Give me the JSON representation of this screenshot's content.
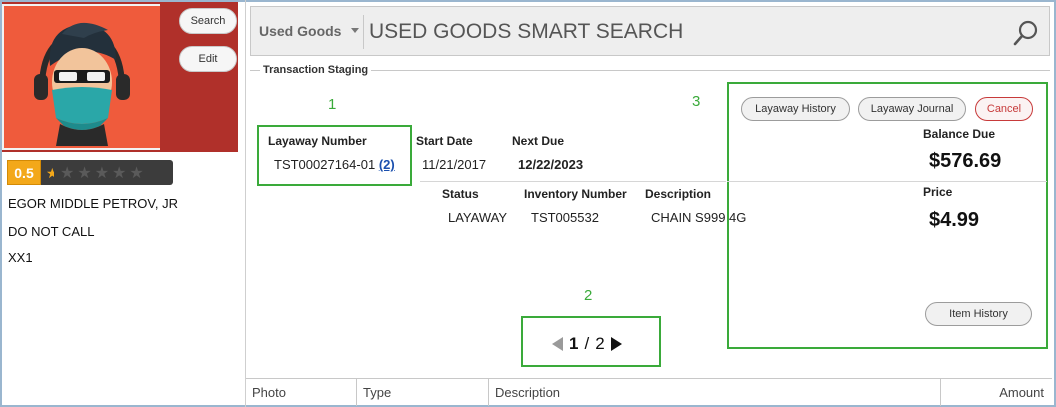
{
  "customer": {
    "search_label": "Search",
    "edit_label": "Edit",
    "rating": "0.5",
    "name": "EGOR MIDDLE PETROV, JR",
    "note": "DO NOT CALL",
    "code": "XX1"
  },
  "search": {
    "category": "Used Goods",
    "placeholder": "USED GOODS SMART SEARCH"
  },
  "staging": {
    "title": "Transaction Staging",
    "layaway_number_label": "Layaway Number",
    "layaway_number": "TST00027164-01",
    "layaway_count": "(2)",
    "start_date_label": "Start Date",
    "start_date": "11/21/2017",
    "next_due_label": "Next Due",
    "next_due": "12/22/2023",
    "status_label": "Status",
    "status": "LAYAWAY",
    "inventory_label": "Inventory Number",
    "inventory": "TST005532",
    "description_label": "Description",
    "description": "CHAIN S999 4G",
    "balance_due_label": "Balance Due",
    "balance_due": "$576.69",
    "price_label": "Price",
    "price": "$4.99",
    "layaway_history_label": "Layaway History",
    "layaway_journal_label": "Layaway Journal",
    "cancel_label": "Cancel",
    "item_history_label": "Item History"
  },
  "pager": {
    "current": "1",
    "separator": "/",
    "total": "2"
  },
  "annotations": [
    "1",
    "2",
    "3"
  ],
  "table": {
    "columns": [
      "Photo",
      "Type",
      "Description",
      "Amount"
    ]
  },
  "colors": {
    "annotation": "#3aaa3a",
    "avatar_bg": "#ef5b3c",
    "panel_bg": "#b0302a",
    "rating": "#f3a81a",
    "link": "#1a4fae",
    "cancel": "#c73a3a"
  }
}
